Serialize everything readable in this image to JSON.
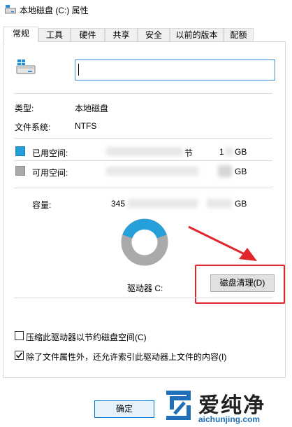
{
  "window": {
    "title": "本地磁盘 (C:) 属性"
  },
  "tabs": [
    {
      "label": "常规"
    },
    {
      "label": "工具"
    },
    {
      "label": "硬件"
    },
    {
      "label": "共享"
    },
    {
      "label": "安全"
    },
    {
      "label": "以前的版本"
    },
    {
      "label": "配额"
    }
  ],
  "general": {
    "name_value": "",
    "type_label": "类型:",
    "type_value": "本地磁盘",
    "fs_label": "文件系统:",
    "fs_value": "NTFS",
    "used_label": "已用空间:",
    "used_bytes_suffix": "节",
    "used_gb_prefix": "1",
    "used_gb_unit": "GB",
    "free_label": "可用空间:",
    "free_gb_unit": "GB",
    "capacity_label": "容量:",
    "capacity_bytes_prefix": "345",
    "capacity_gb_unit": "GB",
    "drive_label": "驱动器 C:",
    "cleanup_button": "磁盘清理(D)",
    "compress_label": "压缩此驱动器以节约磁盘空间(C)",
    "compress_checked": false,
    "index_label": "除了文件属性外，还允许索引此驱动器上文件的内容(I)",
    "index_checked": true
  },
  "footer": {
    "ok_button": "确定"
  },
  "watermark": {
    "brand": "爱纯净",
    "url": "aichunjing.com"
  },
  "colors": {
    "used": "#26a0da",
    "free": "#aaaaaa",
    "accent_border": "#3c8cd6",
    "annotation": "#e0262b"
  }
}
